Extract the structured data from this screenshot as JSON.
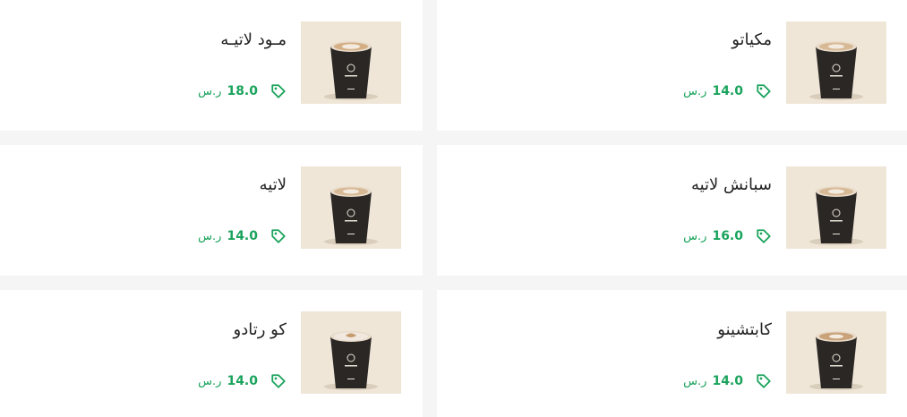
{
  "products": [
    {
      "name": "مكياتو",
      "amount": "14.0",
      "currency": "ر.س",
      "icon": "price-tag-icon"
    },
    {
      "name": "مـود لاتيـه",
      "amount": "18.0",
      "currency": "ر.س",
      "icon": "price-tag-icon"
    },
    {
      "name": "سبانش لاتيه",
      "amount": "16.0",
      "currency": "ر.س",
      "icon": "price-tag-icon"
    },
    {
      "name": "لاتيه",
      "amount": "14.0",
      "currency": "ر.س",
      "icon": "price-tag-icon"
    },
    {
      "name": "كابتشينو",
      "amount": "14.0",
      "currency": "ر.س",
      "icon": "price-tag-icon"
    },
    {
      "name": "كو رتادو",
      "amount": "14.0",
      "currency": "ر.س",
      "icon": "price-tag-icon"
    }
  ],
  "colors": {
    "accent": "#1aa35c",
    "text": "#222222",
    "card": "#ffffff",
    "background": "#f5f5f5"
  }
}
